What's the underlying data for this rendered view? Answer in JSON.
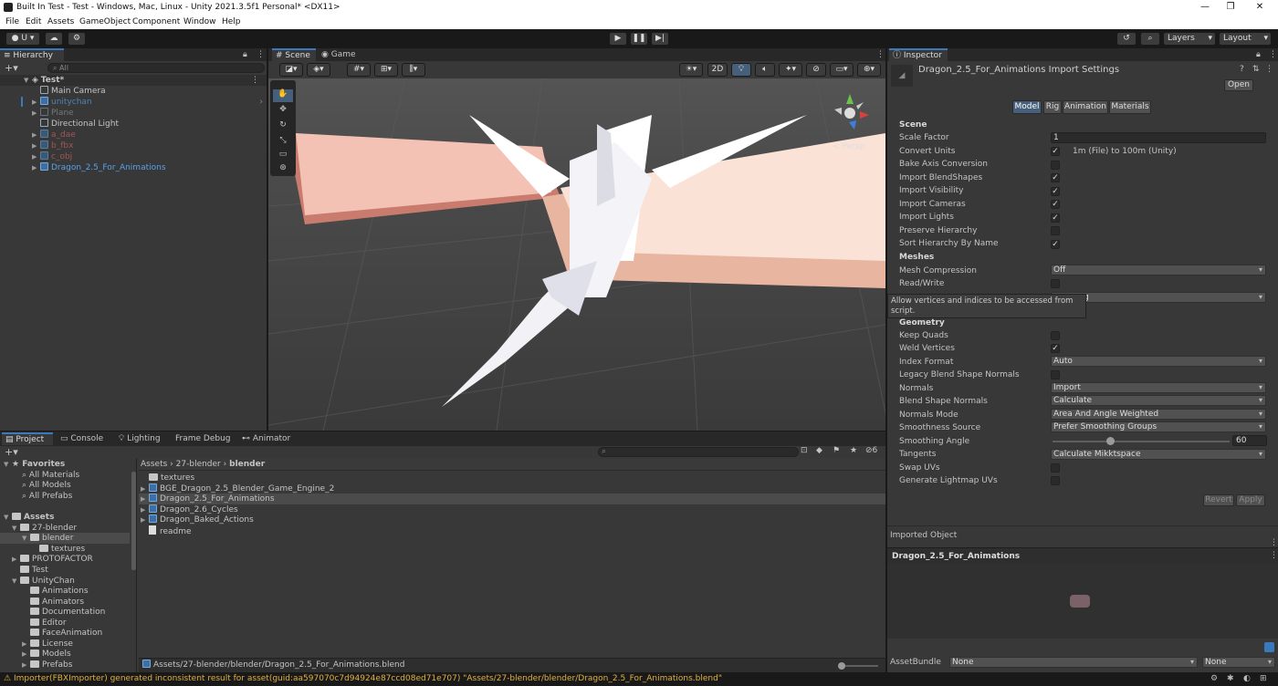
{
  "window": {
    "title": "Built In Test - Test - Windows, Mac, Linux - Unity 2021.3.5f1 Personal* <DX11>",
    "controls": [
      "—",
      "❐",
      "✕"
    ]
  },
  "menu": [
    "File",
    "Edit",
    "Assets",
    "GameObject",
    "Component",
    "Window",
    "Help"
  ],
  "toolbar": {
    "account_label": "U",
    "layers_label": "Layers",
    "layout_label": "Layout"
  },
  "hierarchy": {
    "tab": "Hierarchy",
    "search_placeholder": "All",
    "scene_name": "Test*",
    "items": [
      {
        "label": "Main Camera",
        "style": "normal"
      },
      {
        "label": "unitychan",
        "style": "blue"
      },
      {
        "label": "Plane",
        "style": "dim"
      },
      {
        "label": "Directional Light",
        "style": "normal"
      },
      {
        "label": "a_dae",
        "style": "red"
      },
      {
        "label": "b_fbx",
        "style": "red"
      },
      {
        "label": "c_obj",
        "style": "red"
      },
      {
        "label": "Dragon_2.5_For_Animations",
        "style": "blue"
      }
    ]
  },
  "scene": {
    "tabs": [
      "Scene",
      "Game"
    ],
    "mode_2d": "2D",
    "persp_label": "Persp"
  },
  "inspector": {
    "tab": "Inspector",
    "title": "Dragon_2.5_For_Animations Import Settings",
    "open_button": "Open",
    "tabs": [
      "Model",
      "Rig",
      "Animation",
      "Materials"
    ],
    "section_scene": "Scene",
    "scale_factor_label": "Scale Factor",
    "scale_factor_value": "1",
    "convert_units_label": "Convert Units",
    "convert_units_note": "1m (File) to 100m (Unity)",
    "bake_axis_label": "Bake Axis Conversion",
    "import_blendshapes_label": "Import BlendShapes",
    "import_visibility_label": "Import Visibility",
    "import_cameras_label": "Import Cameras",
    "import_lights_label": "Import Lights",
    "preserve_hierarchy_label": "Preserve Hierarchy",
    "sort_hierarchy_label": "Sort Hierarchy By Name",
    "section_meshes": "Meshes",
    "mesh_compression_label": "Mesh Compression",
    "mesh_compression_value": "Off",
    "read_write_label": "Read/Write",
    "hidden_dropdown_tail": "g",
    "tooltip": "Allow vertices and indices to be accessed from script.",
    "section_geometry": "Geometry",
    "keep_quads_label": "Keep Quads",
    "weld_vertices_label": "Weld Vertices",
    "index_format_label": "Index Format",
    "index_format_value": "Auto",
    "legacy_blend_label": "Legacy Blend Shape Normals",
    "normals_label": "Normals",
    "normals_value": "Import",
    "blend_shape_normals_label": "Blend Shape Normals",
    "blend_shape_normals_value": "Calculate",
    "normals_mode_label": "Normals Mode",
    "normals_mode_value": "Area And Angle Weighted",
    "smoothness_source_label": "Smoothness Source",
    "smoothness_source_value": "Prefer Smoothing Groups",
    "smoothing_angle_label": "Smoothing Angle",
    "smoothing_angle_value": "60",
    "tangents_label": "Tangents",
    "tangents_value": "Calculate Mikktspace",
    "swap_uvs_label": "Swap UVs",
    "lightmap_uvs_label": "Generate Lightmap UVs",
    "revert_button": "Revert",
    "apply_button": "Apply",
    "imported_object_label": "Imported Object",
    "preview_title": "Dragon_2.5_For_Animations",
    "assetbundle_label": "AssetBundle",
    "assetbundle_value": "None",
    "assetbundle_variant": "None"
  },
  "project": {
    "tabs": [
      "Project",
      "Console",
      "Lighting",
      "Frame Debug",
      "Animator"
    ],
    "hidden_count": "6",
    "favorites_label": "Favorites",
    "favorites": [
      "All Materials",
      "All Models",
      "All Prefabs"
    ],
    "assets_label": "Assets",
    "tree": [
      {
        "label": "27-blender",
        "indent": 1
      },
      {
        "label": "blender",
        "indent": 2
      },
      {
        "label": "textures",
        "indent": 3
      },
      {
        "label": "PROTOFACTOR",
        "indent": 1
      },
      {
        "label": "Test",
        "indent": 1
      },
      {
        "label": "UnityChan",
        "indent": 1
      },
      {
        "label": "Animations",
        "indent": 2
      },
      {
        "label": "Animators",
        "indent": 2
      },
      {
        "label": "Documentation",
        "indent": 2
      },
      {
        "label": "Editor",
        "indent": 2
      },
      {
        "label": "FaceAnimation",
        "indent": 2
      },
      {
        "label": "License",
        "indent": 2
      },
      {
        "label": "Models",
        "indent": 2
      },
      {
        "label": "Prefabs",
        "indent": 2
      }
    ],
    "breadcrumb": [
      "Assets",
      "27-blender",
      "blender"
    ],
    "files": [
      {
        "label": "textures",
        "kind": "folder"
      },
      {
        "label": "BGE_Dragon_2.5_Blender_Game_Engine_2",
        "kind": "model"
      },
      {
        "label": "Dragon_2.5_For_Animations",
        "kind": "model"
      },
      {
        "label": "Dragon_2.6_Cycles",
        "kind": "model"
      },
      {
        "label": "Dragon_Baked_Actions",
        "kind": "model"
      },
      {
        "label": "readme",
        "kind": "text"
      }
    ],
    "selected_path": "Assets/27-blender/blender/Dragon_2.5_For_Animations.blend"
  },
  "status": {
    "message": "Importer(FBXImporter) generated inconsistent result for asset(guid:aa597070c7d94924e87ccd08ed71e707) \"Assets/27-blender/blender/Dragon_2.5_For_Animations.blend\""
  },
  "colors": {
    "accent": "#3a79bb",
    "panel": "#383838",
    "warning": "#e0b040"
  }
}
